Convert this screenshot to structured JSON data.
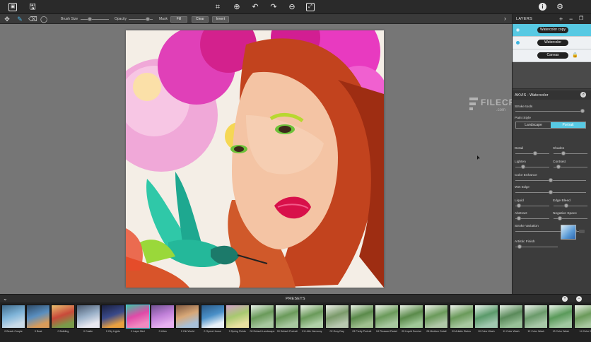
{
  "toolbar": {
    "icons": [
      "image-icon",
      "save-icon",
      "crop-icon",
      "zoom-in-icon",
      "undo-icon",
      "redo-icon",
      "zoom-out-icon",
      "fit-icon",
      "info-icon",
      "settings-icon"
    ]
  },
  "options": {
    "brush_size_label": "Brush Size",
    "opacity_label": "Opacity",
    "mask_label": "Mask",
    "fill_label": "Fill",
    "clear_label": "Clear",
    "invert_label": "Invert",
    "brush_size_value": 0.3,
    "opacity_value": 0.85
  },
  "layers": {
    "title": "LAYERS",
    "add_label": "+",
    "items": [
      {
        "name": "Watercolor copy",
        "selected": true
      },
      {
        "name": "Watercolor",
        "selected": false
      },
      {
        "name": "Canvas",
        "selected": false,
        "locked": true
      }
    ]
  },
  "filter": {
    "title": "AKVIS - Watercolor",
    "stroke_tools_label": "Stroke tools",
    "paint_style_label": "Paint Style",
    "paint_style_options": [
      "Landscape",
      "Portrait"
    ],
    "paint_style_selected": "Portrait",
    "params": {
      "detail": {
        "label": "Detail",
        "value": 0.6
      },
      "shades": {
        "label": "Shades",
        "value": 0.25
      },
      "lighten": {
        "label": "Lighten",
        "value": 0.2
      },
      "contrast": {
        "label": "Contrast",
        "value": 0.1
      },
      "color_enhance": {
        "label": "Color Enhance",
        "value": 0.5
      },
      "wet_edge": {
        "label": "Wet Edge",
        "value": 0.5
      },
      "liquid": {
        "label": "Liquid",
        "value": 0.05
      },
      "edge_bleed": {
        "label": "Edge Bleed",
        "value": 0.35
      },
      "abstract": {
        "label": "Abstract",
        "value": 0.05
      },
      "negative_space": {
        "label": "Negative Space",
        "value": 0.15
      },
      "stroke_variation": {
        "label": "Stroke Variation",
        "value": 0.9
      },
      "artistic_finish": {
        "label": "Artistic Finish",
        "value": 0.05
      }
    }
  },
  "presets": {
    "title": "PRESETS",
    "items": [
      {
        "label": "0 Beach Couple",
        "colors": [
          "#7fb4d8",
          "#c9dbe8",
          "#3f6a8a"
        ]
      },
      {
        "label": "0 Boat",
        "colors": [
          "#5a8fc0",
          "#d89b5a",
          "#2e4a66"
        ]
      },
      {
        "label": "0 Building",
        "colors": [
          "#c94a3a",
          "#7a9a4a",
          "#e8c070"
        ]
      },
      {
        "label": "0 Castle",
        "colors": [
          "#9ab0c8",
          "#e8e8f0",
          "#4a5a70"
        ]
      },
      {
        "label": "0 City Lights",
        "colors": [
          "#3a4a8a",
          "#e8a040",
          "#1a2040"
        ]
      },
      {
        "label": "0 Layer Bird",
        "colors": [
          "#e04aa8",
          "#f08ac0",
          "#40c0a0"
        ]
      },
      {
        "label": "0 Lilies",
        "colors": [
          "#c080d8",
          "#e8b0f0",
          "#705090"
        ]
      },
      {
        "label": "0 Old World",
        "colors": [
          "#d8a878",
          "#a8c0d8",
          "#805840"
        ]
      },
      {
        "label": "0 Opera House",
        "colors": [
          "#4a90c8",
          "#e8f0f8",
          "#2a5a88"
        ]
      },
      {
        "label": "0 Spring Fields",
        "colors": [
          "#a8c870",
          "#e8e0a0",
          "#d0a0c8"
        ]
      },
      {
        "label": "00 Default Landscape",
        "colors": [
          "#6a9a5a",
          "#a8c8a0",
          "#e8f0e8"
        ]
      },
      {
        "label": "00 Default Portrait",
        "colors": [
          "#6a9a5a",
          "#a8c8a0",
          "#e8f0e8"
        ]
      },
      {
        "label": "01 Little Harmony",
        "colors": [
          "#6a9a5a",
          "#b0d0a8",
          "#eef4ea"
        ]
      },
      {
        "label": "02 Gray Day",
        "colors": [
          "#7a9a6a",
          "#b8c8b0",
          "#eef0ea"
        ]
      },
      {
        "label": "03 Pretty Portrait",
        "colors": [
          "#5a8a4a",
          "#a0c090",
          "#eaf2e6"
        ]
      },
      {
        "label": "04 Pleasant Pastel",
        "colors": [
          "#6a9a5a",
          "#a8c8a0",
          "#eef4ea"
        ]
      },
      {
        "label": "05 Liquid Sunrise",
        "colors": [
          "#5a8a4a",
          "#a0c898",
          "#eaf2e6"
        ]
      },
      {
        "label": "06 Medium Detail",
        "colors": [
          "#6a9a5a",
          "#b0c8a8",
          "#eef2ea"
        ]
      },
      {
        "label": "09 Artistic Stains",
        "colors": [
          "#6a9a5a",
          "#a8c8a0",
          "#f0f4ee"
        ]
      },
      {
        "label": "10 Color Wash",
        "colors": [
          "#5a9a6a",
          "#a0c8b0",
          "#eaf4ee"
        ]
      },
      {
        "label": "11 Color Wash",
        "colors": [
          "#5a8a5a",
          "#98c098",
          "#e8f2e8"
        ]
      },
      {
        "label": "12 Color Wash",
        "colors": [
          "#6a9a6a",
          "#a8c8a8",
          "#eef4ee"
        ]
      },
      {
        "label": "13 Color Wash",
        "colors": [
          "#5a9a5a",
          "#a0c8a0",
          "#eaf4ea"
        ]
      },
      {
        "label": "14 Color W",
        "colors": [
          "#6a9a5a",
          "#a8c8a0",
          "#eef4ea"
        ]
      }
    ]
  },
  "watermark": {
    "text": "FILECR",
    "sub": ".com"
  }
}
